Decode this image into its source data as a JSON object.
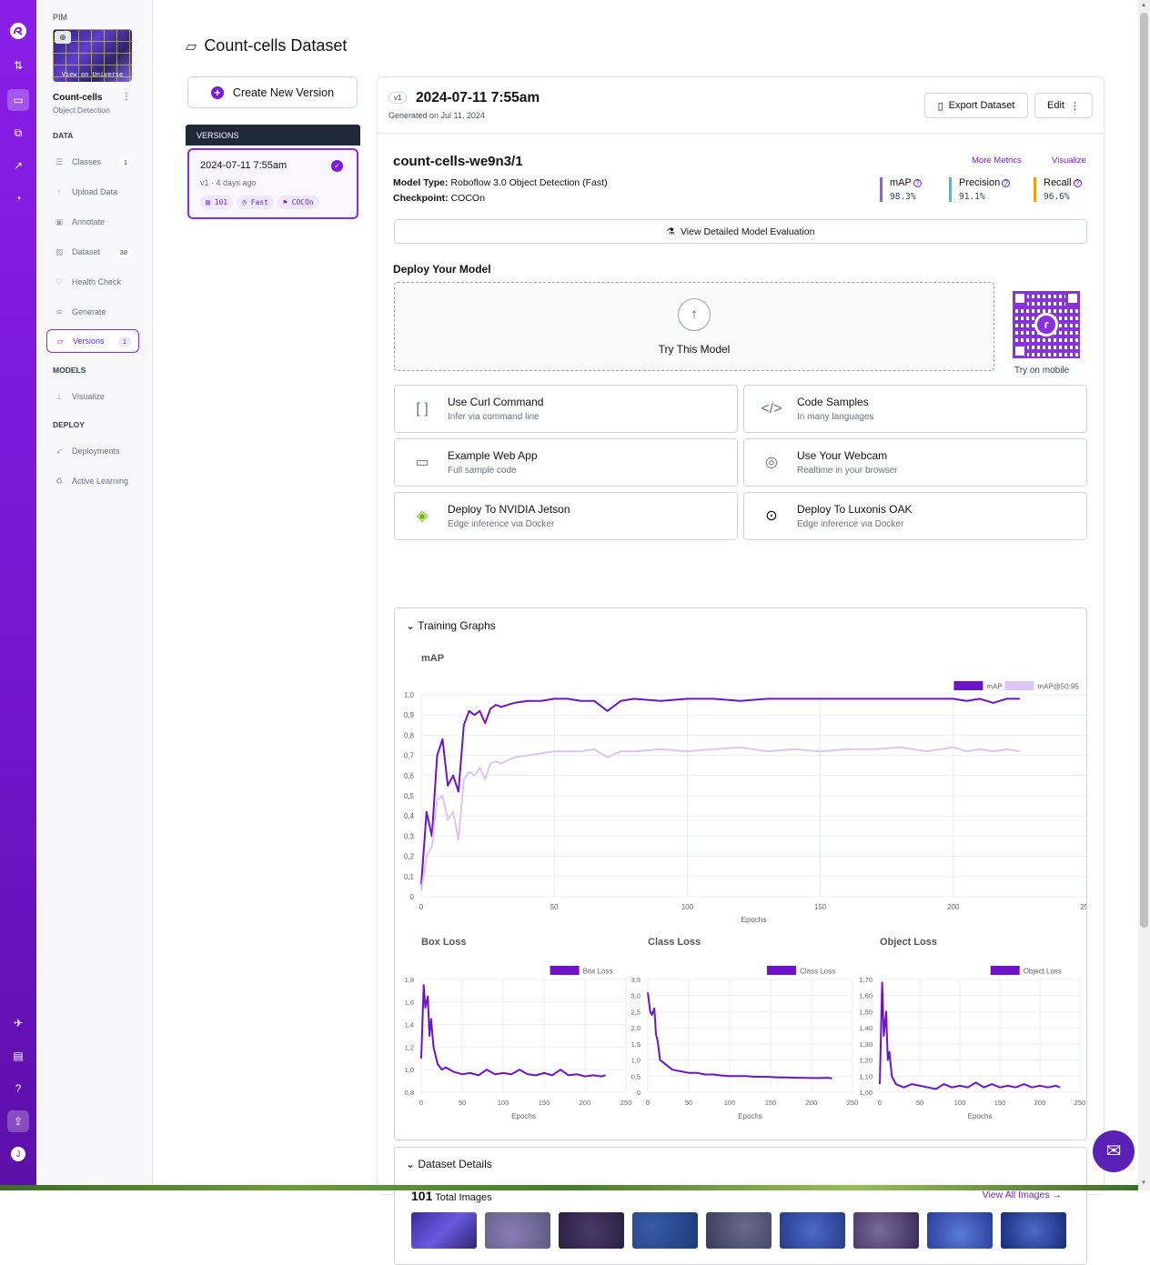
{
  "rail": {
    "icons": [
      "roboflow-logo-icon",
      "swap-icon",
      "inbox-icon",
      "workflow-icon",
      "chart-icon",
      "bell-icon",
      "rocket-icon",
      "book-icon",
      "help-icon",
      "upload-icon",
      "user-avatar"
    ],
    "avatar": "J"
  },
  "sidebar": {
    "workspace": "PIM",
    "view_on_universe": "View on Universe",
    "project_name": "Count-cells",
    "project_type": "Object Detection",
    "sections": {
      "data": "DATA",
      "models": "MODELS",
      "deploy": "DEPLOY"
    },
    "items": [
      {
        "label": "Classes",
        "count": "1"
      },
      {
        "label": "Upload Data",
        "count": ""
      },
      {
        "label": "Annotate",
        "count": ""
      },
      {
        "label": "Dataset",
        "count": "38"
      },
      {
        "label": "Health Check",
        "count": ""
      },
      {
        "label": "Generate",
        "count": ""
      },
      {
        "label": "Versions",
        "count": "1"
      },
      {
        "label": "Visualize",
        "count": ""
      },
      {
        "label": "Deployments",
        "count": ""
      },
      {
        "label": "Active Learning",
        "count": ""
      }
    ]
  },
  "page": {
    "title": "Count-cells Dataset"
  },
  "versions": {
    "create_label": "Create New Version",
    "header": "VERSIONS",
    "card": {
      "date": "2024-07-11 7:55am",
      "sub": "v1 · 4 days ago",
      "tags": [
        "101",
        "Fast",
        "COCOn"
      ]
    }
  },
  "version": {
    "badge": "v1",
    "title": "2024-07-11 7:55am",
    "generated": "Generated on Jul 11, 2024",
    "export_label": "Export Dataset",
    "edit_label": "Edit"
  },
  "model": {
    "name": "count-cells-we9n3/1",
    "type_label": "Model Type:",
    "type_value": "Roboflow 3.0 Object Detection (Fast)",
    "checkpoint_label": "Checkpoint:",
    "checkpoint_value": "COCOn",
    "more_metrics": "More Metrics",
    "visualize": "Visualize",
    "metrics": [
      {
        "name": "mAP",
        "value": "98.3%",
        "color": "#8b5cf6"
      },
      {
        "name": "Precision",
        "value": "91.1%",
        "color": "#38bdf8"
      },
      {
        "name": "Recall",
        "value": "96.6%",
        "color": "#f59e0b"
      }
    ],
    "eval_label": "View Detailed Model Evaluation"
  },
  "deploy": {
    "heading": "Deploy Your Model",
    "try_label": "Try This Model",
    "mobile_label": "Try on mobile",
    "tiles": [
      {
        "title": "Use Curl Command",
        "sub": "Infer via command line",
        "icon": "brackets-icon"
      },
      {
        "title": "Code Samples",
        "sub": "In many languages",
        "icon": "code-icon"
      },
      {
        "title": "Example Web App",
        "sub": "Full sample code",
        "icon": "browser-window-icon"
      },
      {
        "title": "Use Your Webcam",
        "sub": "Realtime in your browser",
        "icon": "webcam-icon"
      },
      {
        "title": "Deploy To NVIDIA Jetson",
        "sub": "Edge inference via Docker",
        "icon": "nvidia-icon"
      },
      {
        "title": "Deploy To Luxonis OAK",
        "sub": "Edge inference via Docker",
        "icon": "luxonis-icon"
      }
    ]
  },
  "training": {
    "heading": "Training Graphs"
  },
  "chart_data": [
    {
      "type": "line",
      "title": "mAP",
      "xlabel": "Epochs",
      "ylabel": "",
      "xlim": [
        0,
        250
      ],
      "ylim": [
        0,
        1.0
      ],
      "xticks": [
        "0",
        "50",
        "100",
        "150",
        "200",
        "250"
      ],
      "yticks": [
        "0",
        "0,1",
        "0,2",
        "0,3",
        "0,4",
        "0,5",
        "0,6",
        "0,7",
        "0,8",
        "0,9",
        "1,0"
      ],
      "legend": "top-right",
      "series": [
        {
          "name": "mAP",
          "color": "#6d14c9",
          "x": [
            0,
            2,
            4,
            6,
            8,
            10,
            12,
            14,
            16,
            18,
            20,
            22,
            24,
            26,
            28,
            30,
            35,
            40,
            45,
            50,
            55,
            60,
            65,
            70,
            75,
            80,
            90,
            100,
            110,
            120,
            130,
            140,
            150,
            160,
            170,
            180,
            190,
            200,
            205,
            210,
            215,
            220,
            225
          ],
          "y": [
            0.06,
            0.42,
            0.3,
            0.7,
            0.78,
            0.55,
            0.6,
            0.52,
            0.85,
            0.92,
            0.9,
            0.92,
            0.86,
            0.93,
            0.95,
            0.94,
            0.96,
            0.97,
            0.97,
            0.98,
            0.98,
            0.97,
            0.97,
            0.92,
            0.97,
            0.98,
            0.97,
            0.98,
            0.98,
            0.97,
            0.98,
            0.98,
            0.98,
            0.98,
            0.98,
            0.98,
            0.98,
            0.98,
            0.97,
            0.98,
            0.96,
            0.98,
            0.98
          ]
        },
        {
          "name": "mAP@50:95",
          "color": "#dcc4f5",
          "x": [
            0,
            2,
            4,
            6,
            8,
            10,
            12,
            14,
            16,
            18,
            20,
            22,
            24,
            26,
            28,
            30,
            35,
            40,
            45,
            50,
            55,
            60,
            65,
            70,
            75,
            80,
            90,
            100,
            110,
            120,
            130,
            140,
            150,
            160,
            170,
            180,
            190,
            200,
            205,
            210,
            215,
            220,
            225
          ],
          "y": [
            0.03,
            0.2,
            0.25,
            0.48,
            0.5,
            0.38,
            0.42,
            0.28,
            0.58,
            0.62,
            0.6,
            0.64,
            0.58,
            0.66,
            0.67,
            0.66,
            0.69,
            0.7,
            0.71,
            0.72,
            0.72,
            0.72,
            0.73,
            0.69,
            0.72,
            0.72,
            0.73,
            0.72,
            0.73,
            0.74,
            0.72,
            0.73,
            0.72,
            0.73,
            0.73,
            0.74,
            0.72,
            0.74,
            0.72,
            0.73,
            0.72,
            0.73,
            0.72
          ]
        }
      ]
    },
    {
      "type": "line",
      "title": "Box Loss",
      "xlabel": "Epochs",
      "ylabel": "",
      "xlim": [
        0,
        250
      ],
      "ylim": [
        0.8,
        1.8
      ],
      "xticks": [
        "0",
        "50",
        "100",
        "150",
        "200",
        "250"
      ],
      "yticks": [
        "0,8",
        "1,0",
        "1,2",
        "1,4",
        "1,6",
        "1,8"
      ],
      "legend": "top-right",
      "series": [
        {
          "name": "Box Loss",
          "color": "#6d14c9",
          "x": [
            0,
            3,
            5,
            8,
            10,
            12,
            15,
            20,
            25,
            30,
            40,
            50,
            60,
            70,
            80,
            90,
            100,
            110,
            120,
            130,
            140,
            150,
            160,
            170,
            180,
            190,
            200,
            210,
            220,
            225
          ],
          "y": [
            1.1,
            1.75,
            1.55,
            1.65,
            1.3,
            1.45,
            1.2,
            1.05,
            1.0,
            1.02,
            0.98,
            0.96,
            0.97,
            0.95,
            1.0,
            0.96,
            0.97,
            0.96,
            1.0,
            0.96,
            0.95,
            0.97,
            0.95,
            1.0,
            0.95,
            0.96,
            0.94,
            0.95,
            0.94,
            0.95
          ]
        }
      ]
    },
    {
      "type": "line",
      "title": "Class Loss",
      "xlabel": "Epochs",
      "ylabel": "",
      "xlim": [
        0,
        250
      ],
      "ylim": [
        0,
        3.5
      ],
      "xticks": [
        "0",
        "50",
        "100",
        "150",
        "200",
        "250"
      ],
      "yticks": [
        "0",
        "0,5",
        "1,0",
        "1,5",
        "2,0",
        "2,5",
        "3,0",
        "3,5"
      ],
      "legend": "top-right",
      "series": [
        {
          "name": "Class Loss",
          "color": "#6d14c9",
          "x": [
            0,
            3,
            5,
            8,
            10,
            12,
            15,
            20,
            25,
            30,
            40,
            50,
            60,
            70,
            80,
            90,
            100,
            110,
            120,
            130,
            140,
            150,
            160,
            170,
            180,
            190,
            200,
            210,
            220,
            225
          ],
          "y": [
            3.1,
            2.5,
            2.4,
            2.6,
            1.8,
            1.6,
            1.0,
            0.9,
            0.8,
            0.7,
            0.65,
            0.6,
            0.6,
            0.55,
            0.55,
            0.52,
            0.5,
            0.5,
            0.5,
            0.48,
            0.48,
            0.47,
            0.46,
            0.46,
            0.45,
            0.45,
            0.44,
            0.44,
            0.45,
            0.43
          ]
        }
      ]
    },
    {
      "type": "line",
      "title": "Object Loss",
      "xlabel": "Epochs",
      "ylabel": "",
      "xlim": [
        0,
        250
      ],
      "ylim": [
        1.0,
        1.7
      ],
      "xticks": [
        "0",
        "50",
        "100",
        "150",
        "200",
        "250"
      ],
      "yticks": [
        "1,00",
        "1,10",
        "1,20",
        "1,30",
        "1,40",
        "1,50",
        "1,60",
        "1,70"
      ],
      "legend": "top-right",
      "series": [
        {
          "name": "Object Loss",
          "color": "#6d14c9",
          "x": [
            0,
            3,
            5,
            8,
            10,
            12,
            15,
            20,
            25,
            30,
            40,
            50,
            60,
            70,
            80,
            90,
            100,
            110,
            120,
            130,
            140,
            150,
            160,
            170,
            180,
            190,
            200,
            210,
            220,
            225
          ],
          "y": [
            1.05,
            1.68,
            1.35,
            1.5,
            1.2,
            1.25,
            1.1,
            1.05,
            1.04,
            1.03,
            1.05,
            1.04,
            1.03,
            1.02,
            1.05,
            1.03,
            1.04,
            1.03,
            1.06,
            1.03,
            1.05,
            1.03,
            1.04,
            1.03,
            1.05,
            1.03,
            1.04,
            1.03,
            1.04,
            1.03
          ]
        }
      ]
    }
  ],
  "dataset": {
    "heading": "Dataset Details",
    "total_count": "101",
    "total_label": "Total Images",
    "view_all": "View All Images →"
  }
}
